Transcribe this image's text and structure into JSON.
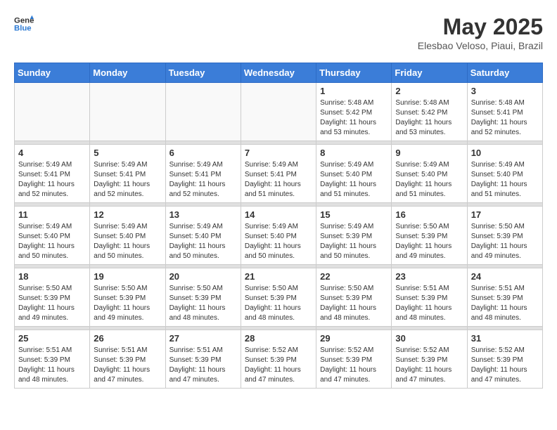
{
  "header": {
    "logo_line1": "General",
    "logo_line2": "Blue",
    "month": "May 2025",
    "location": "Elesbao Veloso, Piaui, Brazil"
  },
  "weekdays": [
    "Sunday",
    "Monday",
    "Tuesday",
    "Wednesday",
    "Thursday",
    "Friday",
    "Saturday"
  ],
  "weeks": [
    [
      {
        "day": "",
        "detail": ""
      },
      {
        "day": "",
        "detail": ""
      },
      {
        "day": "",
        "detail": ""
      },
      {
        "day": "",
        "detail": ""
      },
      {
        "day": "1",
        "detail": "Sunrise: 5:48 AM\nSunset: 5:42 PM\nDaylight: 11 hours\nand 53 minutes."
      },
      {
        "day": "2",
        "detail": "Sunrise: 5:48 AM\nSunset: 5:42 PM\nDaylight: 11 hours\nand 53 minutes."
      },
      {
        "day": "3",
        "detail": "Sunrise: 5:48 AM\nSunset: 5:41 PM\nDaylight: 11 hours\nand 52 minutes."
      }
    ],
    [
      {
        "day": "4",
        "detail": "Sunrise: 5:49 AM\nSunset: 5:41 PM\nDaylight: 11 hours\nand 52 minutes."
      },
      {
        "day": "5",
        "detail": "Sunrise: 5:49 AM\nSunset: 5:41 PM\nDaylight: 11 hours\nand 52 minutes."
      },
      {
        "day": "6",
        "detail": "Sunrise: 5:49 AM\nSunset: 5:41 PM\nDaylight: 11 hours\nand 52 minutes."
      },
      {
        "day": "7",
        "detail": "Sunrise: 5:49 AM\nSunset: 5:41 PM\nDaylight: 11 hours\nand 51 minutes."
      },
      {
        "day": "8",
        "detail": "Sunrise: 5:49 AM\nSunset: 5:40 PM\nDaylight: 11 hours\nand 51 minutes."
      },
      {
        "day": "9",
        "detail": "Sunrise: 5:49 AM\nSunset: 5:40 PM\nDaylight: 11 hours\nand 51 minutes."
      },
      {
        "day": "10",
        "detail": "Sunrise: 5:49 AM\nSunset: 5:40 PM\nDaylight: 11 hours\nand 51 minutes."
      }
    ],
    [
      {
        "day": "11",
        "detail": "Sunrise: 5:49 AM\nSunset: 5:40 PM\nDaylight: 11 hours\nand 50 minutes."
      },
      {
        "day": "12",
        "detail": "Sunrise: 5:49 AM\nSunset: 5:40 PM\nDaylight: 11 hours\nand 50 minutes."
      },
      {
        "day": "13",
        "detail": "Sunrise: 5:49 AM\nSunset: 5:40 PM\nDaylight: 11 hours\nand 50 minutes."
      },
      {
        "day": "14",
        "detail": "Sunrise: 5:49 AM\nSunset: 5:40 PM\nDaylight: 11 hours\nand 50 minutes."
      },
      {
        "day": "15",
        "detail": "Sunrise: 5:49 AM\nSunset: 5:39 PM\nDaylight: 11 hours\nand 50 minutes."
      },
      {
        "day": "16",
        "detail": "Sunrise: 5:50 AM\nSunset: 5:39 PM\nDaylight: 11 hours\nand 49 minutes."
      },
      {
        "day": "17",
        "detail": "Sunrise: 5:50 AM\nSunset: 5:39 PM\nDaylight: 11 hours\nand 49 minutes."
      }
    ],
    [
      {
        "day": "18",
        "detail": "Sunrise: 5:50 AM\nSunset: 5:39 PM\nDaylight: 11 hours\nand 49 minutes."
      },
      {
        "day": "19",
        "detail": "Sunrise: 5:50 AM\nSunset: 5:39 PM\nDaylight: 11 hours\nand 49 minutes."
      },
      {
        "day": "20",
        "detail": "Sunrise: 5:50 AM\nSunset: 5:39 PM\nDaylight: 11 hours\nand 48 minutes."
      },
      {
        "day": "21",
        "detail": "Sunrise: 5:50 AM\nSunset: 5:39 PM\nDaylight: 11 hours\nand 48 minutes."
      },
      {
        "day": "22",
        "detail": "Sunrise: 5:50 AM\nSunset: 5:39 PM\nDaylight: 11 hours\nand 48 minutes."
      },
      {
        "day": "23",
        "detail": "Sunrise: 5:51 AM\nSunset: 5:39 PM\nDaylight: 11 hours\nand 48 minutes."
      },
      {
        "day": "24",
        "detail": "Sunrise: 5:51 AM\nSunset: 5:39 PM\nDaylight: 11 hours\nand 48 minutes."
      }
    ],
    [
      {
        "day": "25",
        "detail": "Sunrise: 5:51 AM\nSunset: 5:39 PM\nDaylight: 11 hours\nand 48 minutes."
      },
      {
        "day": "26",
        "detail": "Sunrise: 5:51 AM\nSunset: 5:39 PM\nDaylight: 11 hours\nand 47 minutes."
      },
      {
        "day": "27",
        "detail": "Sunrise: 5:51 AM\nSunset: 5:39 PM\nDaylight: 11 hours\nand 47 minutes."
      },
      {
        "day": "28",
        "detail": "Sunrise: 5:52 AM\nSunset: 5:39 PM\nDaylight: 11 hours\nand 47 minutes."
      },
      {
        "day": "29",
        "detail": "Sunrise: 5:52 AM\nSunset: 5:39 PM\nDaylight: 11 hours\nand 47 minutes."
      },
      {
        "day": "30",
        "detail": "Sunrise: 5:52 AM\nSunset: 5:39 PM\nDaylight: 11 hours\nand 47 minutes."
      },
      {
        "day": "31",
        "detail": "Sunrise: 5:52 AM\nSunset: 5:39 PM\nDaylight: 11 hours\nand 47 minutes."
      }
    ]
  ]
}
